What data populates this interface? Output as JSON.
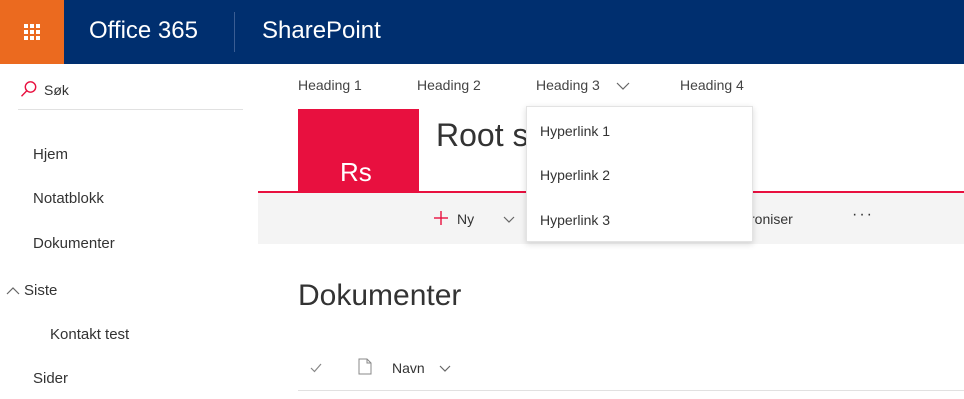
{
  "suitebar": {
    "brand": "Office 365",
    "app": "SharePoint",
    "colors": {
      "bar": "#002f6f",
      "waffle": "#eb6a1f"
    }
  },
  "leftnav": {
    "search_placeholder": "Søk",
    "items": [
      {
        "label": "Hjem"
      },
      {
        "label": "Notatblokk"
      },
      {
        "label": "Dokumenter"
      },
      {
        "label": "Siste"
      },
      {
        "label": "Kontakt test"
      },
      {
        "label": "Sider"
      }
    ]
  },
  "topnav": {
    "items": [
      {
        "label": "Heading 1"
      },
      {
        "label": "Heading 2"
      },
      {
        "label": "Heading 3"
      },
      {
        "label": "Heading 4"
      }
    ]
  },
  "dropdown": {
    "items": [
      {
        "label": "Hyperlink 1"
      },
      {
        "label": "Hyperlink 2"
      },
      {
        "label": "Hyperlink 3"
      }
    ]
  },
  "site": {
    "logo_text": "Rs",
    "title": "Root s",
    "accent": "#e8103f"
  },
  "commandbar": {
    "new_label": "Ny",
    "sync_label": "kroniser",
    "more_label": "···"
  },
  "main": {
    "heading": "Dokumenter",
    "columns": {
      "name": "Navn"
    }
  }
}
